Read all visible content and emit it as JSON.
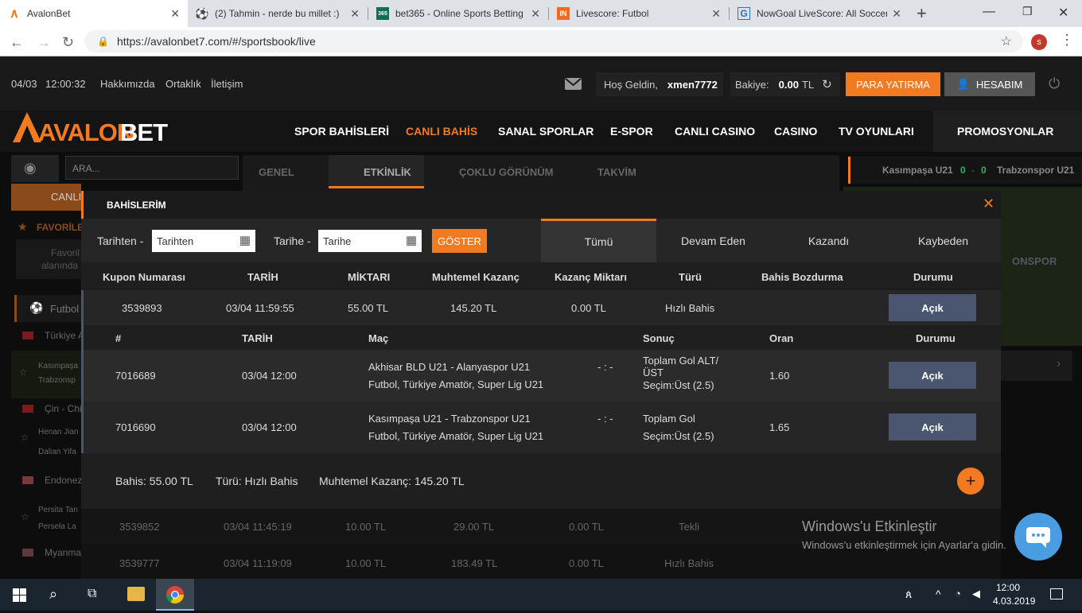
{
  "browser": {
    "tabs": [
      {
        "title": "AvalonBet",
        "icon": "avalonbet-favicon",
        "active": true
      },
      {
        "title": "(2) Tahmin - nerde bu millet :)",
        "icon": "soccer-ball-favicon",
        "active": false
      },
      {
        "title": "bet365 - Online Sports Betting",
        "icon": "bet365-favicon",
        "active": false
      },
      {
        "title": "Livescore: Futbol",
        "icon": "livescore-favicon",
        "active": false
      },
      {
        "title": "NowGoal LiveScore: All Soccer",
        "icon": "nowgoal-favicon",
        "active": false
      }
    ],
    "url": "https://avalonbet7.com/#/sportsbook/live",
    "profile_initial": "s"
  },
  "topbar": {
    "date": "04/03",
    "time": "12:00:32",
    "links": [
      "Hakkımızda",
      "Ortaklık",
      "İletişim"
    ],
    "welcome_label": "Hoş Geldin,",
    "username": "xmen7772",
    "balance_label": "Bakiye:",
    "balance_value": "0.00",
    "balance_currency": "TL",
    "deposit_label": "PARA YATIRMA",
    "account_label": "HESABIM"
  },
  "brand": {
    "name_part1": "AVALON",
    "name_part2": "BET",
    "accent": "#f47a22"
  },
  "mainnav": [
    "SPOR BAHİSLERİ",
    "CANLI BAHİS",
    "SANAL SPORLAR",
    "E-SPOR",
    "CANLI CASINO",
    "CASINO",
    "TV OYUNLARI",
    "PROMOSYONLAR"
  ],
  "background": {
    "search_placeholder": "ARA...",
    "subtabs": [
      "GENEL",
      "ETKİNLİK",
      "ÇOKLU GÖRÜNÜM",
      "TAKVİM"
    ],
    "live_home": "Kasımpaşa U21",
    "live_score_home": "0",
    "live_score_sep": "-",
    "live_score_away": "0",
    "live_away": "Trabzonspor U21",
    "sidebar": [
      "CANLI",
      "FAVORİLE",
      "Favoril",
      "alanında",
      "Futbol",
      "Türkiye A",
      "Kasımpaşa",
      "Trabzonsp",
      "Çin - Chin",
      "Henan Jian",
      "Dalian Yifa",
      "Endonezy",
      "Persita Tan",
      "Persela La",
      "Myanmar"
    ],
    "side_text": "ONSPOR",
    "rows_behind": [
      {
        "kupon": "3539852",
        "tarih": "03/04 11:45:19",
        "miktar": "10.00 TL",
        "kazanc": "29.00 TL",
        "kazanc_miktari": "0.00 TL",
        "turu": "Tekli"
      },
      {
        "kupon": "3539777",
        "tarih": "03/04 11:19:09",
        "miktar": "10.00 TL",
        "kazanc": "183.49 TL",
        "kazanc_miktari": "0.00 TL",
        "turu": "Hızlı Bahis"
      }
    ]
  },
  "modal": {
    "title": "BAHİSLERİM",
    "from_label": "Tarihten -",
    "from_placeholder": "Tarihten",
    "to_label": "Tarihe -",
    "to_placeholder": "Tarihe",
    "show_button": "GÖSTER",
    "filter_tabs": [
      "Tümü",
      "Devam Eden",
      "Kazandı",
      "Kaybeden"
    ],
    "columns": [
      "Kupon Numarası",
      "TARİH",
      "MİKTARI",
      "Muhtemel Kazanç",
      "Kazanç Miktarı",
      "Türü",
      "Bahis Bozdurma",
      "Durumu"
    ],
    "coupon": {
      "kupon": "3539893",
      "tarih": "03/04 11:59:55",
      "miktar": "55.00 TL",
      "kazanc": "145.20 TL",
      "kazanc_miktari": "0.00 TL",
      "turu": "Hızlı Bahis",
      "durum": "Açık"
    },
    "detail_columns": [
      "#",
      "TARİH",
      "Maç",
      "Sonuç",
      "Oran",
      "Durumu"
    ],
    "detail_rows": [
      {
        "id": "7016689",
        "tarih": "03/04 12:00",
        "match": "Akhisar BLD U21 - Alanyaspor U21",
        "league": "Futbol, Türkiye Amatör, Super Lig U21",
        "score": "- : -",
        "result_line1": "Toplam Gol ALT/",
        "result_line2": "ÜST",
        "selection": "Seçim:Üst (2.5)",
        "odds": "1.60",
        "durum": "Açık"
      },
      {
        "id": "7016690",
        "tarih": "03/04 12:00",
        "match": "Kasımpaşa U21 - Trabzonspor U21",
        "league": "Futbol, Türkiye Amatör, Super Lig U21",
        "score": "- : -",
        "result_line1": "Toplam Gol",
        "result_line2": "",
        "selection": "Seçim:Üst (2.5)",
        "odds": "1.65",
        "durum": "Açık"
      }
    ],
    "summary": {
      "bet": "Bahis: 55.00 TL",
      "type": "Türü: Hızlı Bahis",
      "potential": "Muhtemel Kazanç: 145.20 TL"
    }
  },
  "watermark": {
    "title": "Windows'u Etkinleştir",
    "subtitle": "Windows'u etkinleştirmek için Ayarlar'a gidin."
  },
  "taskbar": {
    "time": "12:00",
    "date": "4.03.2019"
  }
}
